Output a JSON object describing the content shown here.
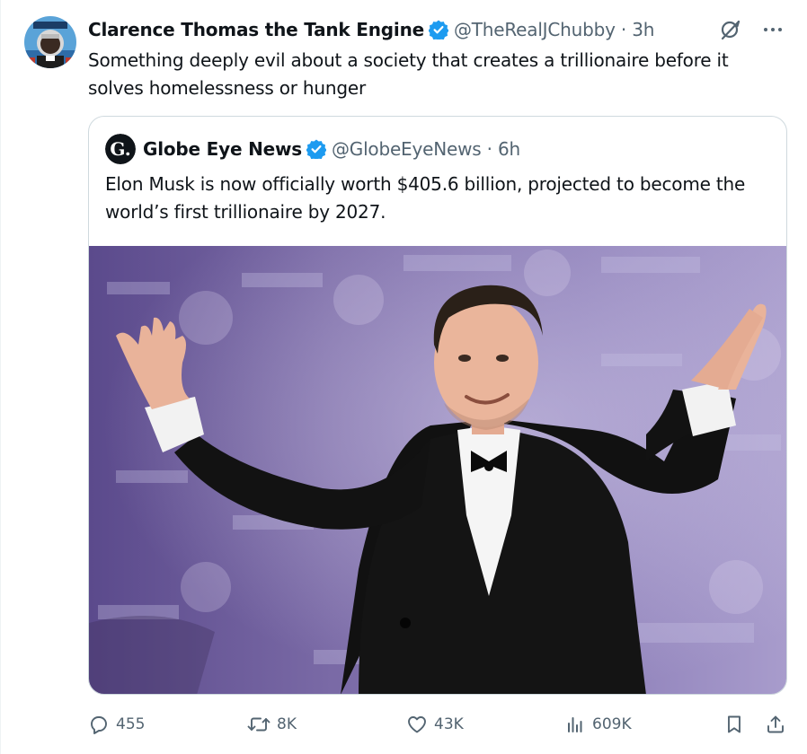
{
  "author": {
    "name": "Clarence Thomas the Tank Engine",
    "handle": "@TheRealJChubby",
    "time": "3h",
    "verified": true,
    "avatar_icon": "avatar-image"
  },
  "tweet": {
    "text": "Something deeply evil about a society that creates a trillionaire before it solves homelessness or hunger"
  },
  "quoted": {
    "name": "Globe Eye News",
    "handle": "@GlobeEyeNews",
    "time": "6h",
    "verified": true,
    "logo_icon": "globe-eye-logo",
    "logo_letter": "G.",
    "text": "Elon Musk is now officially worth $405.6 billion, projected to become the world’s first trillionaire by 2027.",
    "image_icon": "photo-man-in-tuxedo-arms-raised"
  },
  "actions": {
    "replies": "455",
    "reposts": "8K",
    "likes": "43K",
    "views": "609K"
  },
  "separator": " · ",
  "colors": {
    "verified": "#1d9bf0",
    "secondary_text": "#536471",
    "border": "#cfd9de",
    "text": "#0f1419"
  }
}
